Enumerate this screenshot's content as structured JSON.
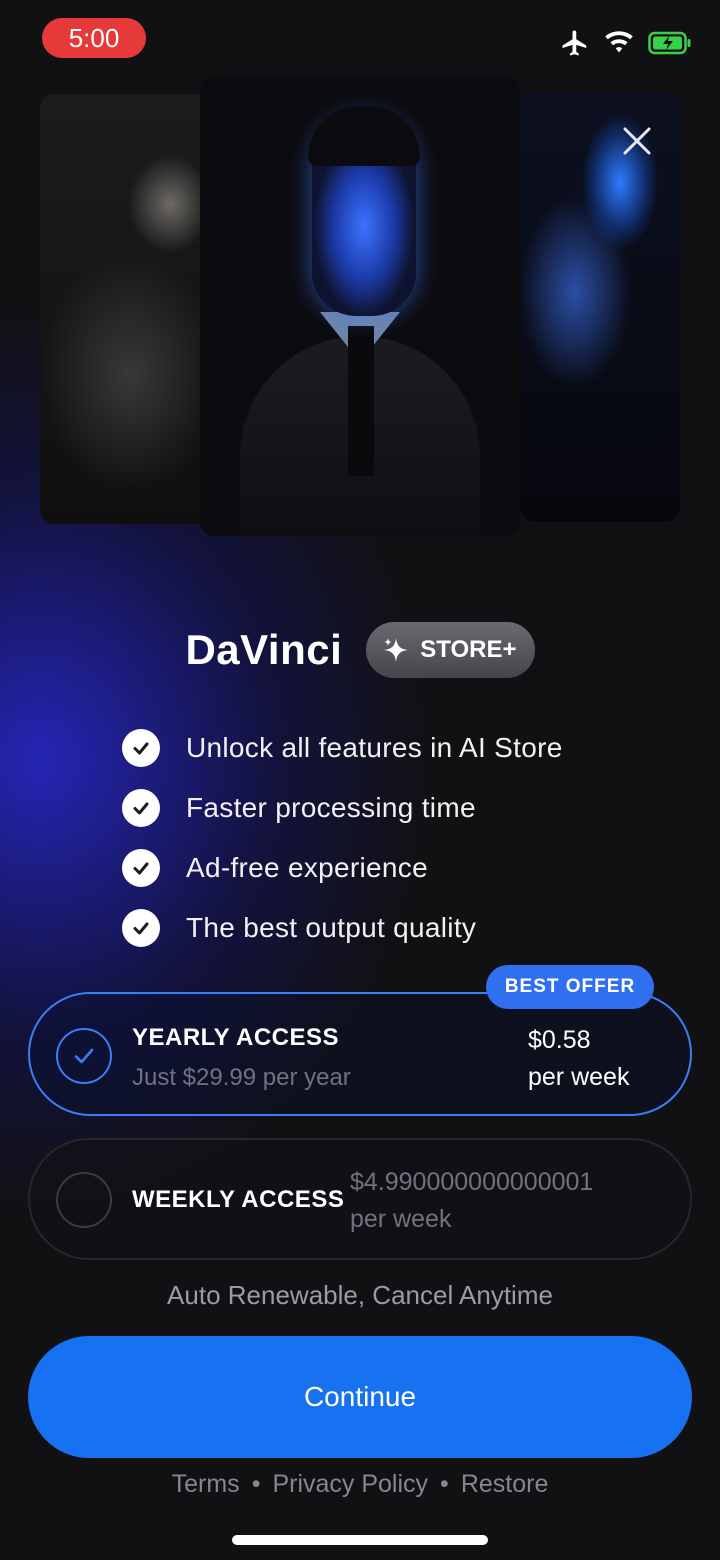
{
  "status_bar": {
    "time": "5:00",
    "icons": [
      "airplane-icon",
      "wifi-icon",
      "battery-charging-icon"
    ],
    "time_pill_color": "#e63a3a"
  },
  "hero": {
    "images": [
      "tattooed-man-portrait",
      "cyber-man-suit-portrait",
      "cyber-woman-portrait"
    ]
  },
  "header": {
    "app_name": "DaVinci",
    "badge_label": "STORE+",
    "badge_icon": "sparkle-icon"
  },
  "features": [
    {
      "label": "Unlock all features in AI Store"
    },
    {
      "label": "Faster processing time"
    },
    {
      "label": "Ad-free experience"
    },
    {
      "label": "The best output quality"
    }
  ],
  "plans": {
    "yearly": {
      "badge": "BEST OFFER",
      "name": "YEARLY ACCESS",
      "subtitle": "Just $29.99 per year",
      "price_line1": "$0.58",
      "price_line2": "per week",
      "selected": true
    },
    "weekly": {
      "name": "WEEKLY ACCESS",
      "price_line1": "$4.990000000000001",
      "price_line2": "per week",
      "selected": false
    }
  },
  "renew_note": "Auto Renewable, Cancel Anytime",
  "continue_label": "Continue",
  "footer": {
    "terms": "Terms",
    "privacy": "Privacy Policy",
    "restore": "Restore",
    "separator": "•"
  },
  "colors": {
    "accent": "#1672f0",
    "selected_border": "#3a7ef5",
    "background": "#111114"
  }
}
